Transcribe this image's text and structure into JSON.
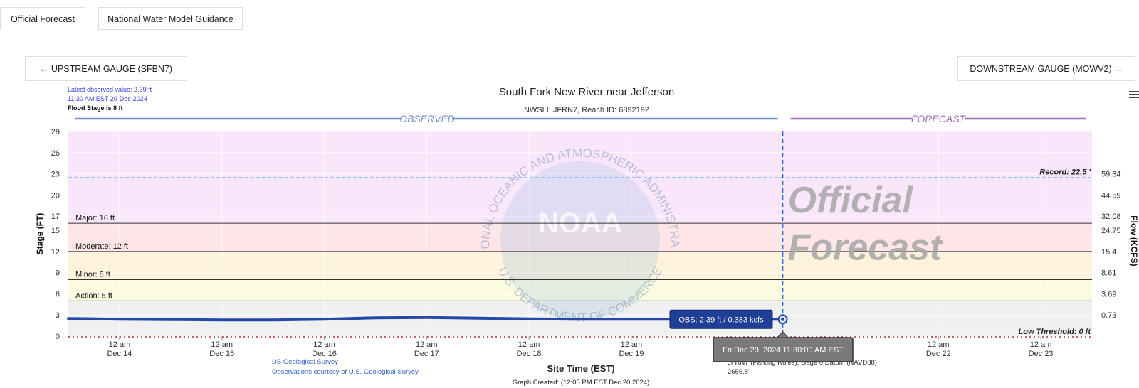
{
  "tabs": [
    {
      "label": "Official Forecast",
      "active": true
    },
    {
      "label": "National Water Model Guidance",
      "active": false
    }
  ],
  "nav": {
    "upstream": {
      "label": "UPSTREAM GAUGE (SFBN7)",
      "arrow": "←"
    },
    "downstream": {
      "label": "DOWNSTREAM GAUGE (MOWV2)",
      "arrow": "→"
    }
  },
  "menu_icon": "hamburger-menu-icon",
  "colors": {
    "observed": "#2449a8",
    "observed_header": "#6f8ed1",
    "forecast_header": "#9b6fc2",
    "record": "#8ec8f0",
    "major_zone": "#f9e6fb",
    "moderate_zone": "#fde5e8",
    "minor_zone": "#fdf2dc",
    "action_zone": "#fbfbe0",
    "normal_zone": "#f0f0f0",
    "tooltip_obs": "#1f3f96",
    "tooltip_time": "#7a7a7a",
    "now_line": "#2a6fd6",
    "low_threshold": "#b03030"
  },
  "chart_data": {
    "type": "line",
    "title": "South Fork New River near Jefferson",
    "subtitle": "NWSLI: JFRN7, Reach ID: 6892192",
    "xlabel": "Site Time (EST)",
    "ylabel": "Stage (FT)",
    "y2label": "Flow (KCFS)",
    "ylim": [
      0,
      29
    ],
    "x_start": "2024-12-13T12:00",
    "x_end": "2024-12-23T12:00",
    "now": "2024-12-20T11:30",
    "yticks": [
      0,
      3,
      6,
      9,
      12,
      15,
      17,
      20,
      23,
      26,
      29
    ],
    "y2ticks": [
      {
        "stage": 3,
        "label": "0.73"
      },
      {
        "stage": 6,
        "label": "3.69"
      },
      {
        "stage": 9,
        "label": "8.61"
      },
      {
        "stage": 12,
        "label": "15.4"
      },
      {
        "stage": 15,
        "label": "24.75"
      },
      {
        "stage": 17,
        "label": "32.08"
      },
      {
        "stage": 20,
        "label": "44.59"
      },
      {
        "stage": 23,
        "label": "59.34"
      }
    ],
    "xticks": [
      {
        "date": "2024-12-14T00:00",
        "time": "12 am",
        "day": "Dec 14"
      },
      {
        "date": "2024-12-15T00:00",
        "time": "12 am",
        "day": "Dec 15"
      },
      {
        "date": "2024-12-16T00:00",
        "time": "12 am",
        "day": "Dec 16"
      },
      {
        "date": "2024-12-17T00:00",
        "time": "12 am",
        "day": "Dec 17"
      },
      {
        "date": "2024-12-18T00:00",
        "time": "12 am",
        "day": "Dec 18"
      },
      {
        "date": "2024-12-19T00:00",
        "time": "12 am",
        "day": "Dec 19"
      },
      {
        "date": "2024-12-22T00:00",
        "time": "12 am",
        "day": "Dec 22"
      },
      {
        "date": "2024-12-23T00:00",
        "time": "12 am",
        "day": "Dec 23"
      }
    ],
    "flood_categories": [
      {
        "name": "Major",
        "label": "Major: 16 ft",
        "stage": 16
      },
      {
        "name": "Moderate",
        "label": "Moderate: 12 ft",
        "stage": 12
      },
      {
        "name": "Minor",
        "label": "Minor: 8 ft",
        "stage": 8
      },
      {
        "name": "Action",
        "label": "Action: 5 ft",
        "stage": 5
      }
    ],
    "record": {
      "label": "Record: 22.5 '",
      "stage": 22.5
    },
    "low_threshold": {
      "label": "Low Threshold: 0 ft",
      "stage": 0
    },
    "section_labels": {
      "observed": "OBSERVED",
      "forecast": "FORECAST"
    },
    "series": [
      {
        "type": "observed",
        "points": [
          [
            "2024-12-13T12:00",
            2.5
          ],
          [
            "2024-12-14T00:00",
            2.4
          ],
          [
            "2024-12-14T12:00",
            2.35
          ],
          [
            "2024-12-15T00:00",
            2.3
          ],
          [
            "2024-12-15T12:00",
            2.3
          ],
          [
            "2024-12-16T00:00",
            2.4
          ],
          [
            "2024-12-16T12:00",
            2.6
          ],
          [
            "2024-12-17T00:00",
            2.65
          ],
          [
            "2024-12-17T12:00",
            2.55
          ],
          [
            "2024-12-18T00:00",
            2.45
          ],
          [
            "2024-12-18T12:00",
            2.4
          ],
          [
            "2024-12-19T00:00",
            2.4
          ],
          [
            "2024-12-19T12:00",
            2.39
          ]
        ]
      }
    ],
    "latest_obs": {
      "date": "2024-12-20T11:30",
      "stage": 2.39
    },
    "tooltip_obs": "OBS: 2.39 ft / 0.383 kcfs",
    "tooltip_time": "Fri Dec 20, 2024 11:30:00 AM EST",
    "watermark_logo": "NOAA",
    "watermark_text": "NATIONAL OCEANIC AND ATMOSPHERIC ADMINISTRATION",
    "watermark_dept": "U.S. DEPARTMENT OF COMMERCE",
    "official_forecast_line1": "Official",
    "official_forecast_line2": "Forecast",
    "latest_value_line1": "Latest observed value: 2.39 ft",
    "latest_value_line2": "11:30 AM EST 20-Dec-2024",
    "flood_stage_note": "Flood Stage is 8 ft",
    "credit_line1": "US Geological Survey",
    "credit_line2": "Observations courtesy of U.S. Geological Survey",
    "datum_line1": "JFRN7 (Parking Rules), Gage 0 Datum (NAVD88):",
    "datum_line2": "2656.8'",
    "graph_created": "Graph Created: (12:05 PM EST Dec 20 2024)"
  }
}
